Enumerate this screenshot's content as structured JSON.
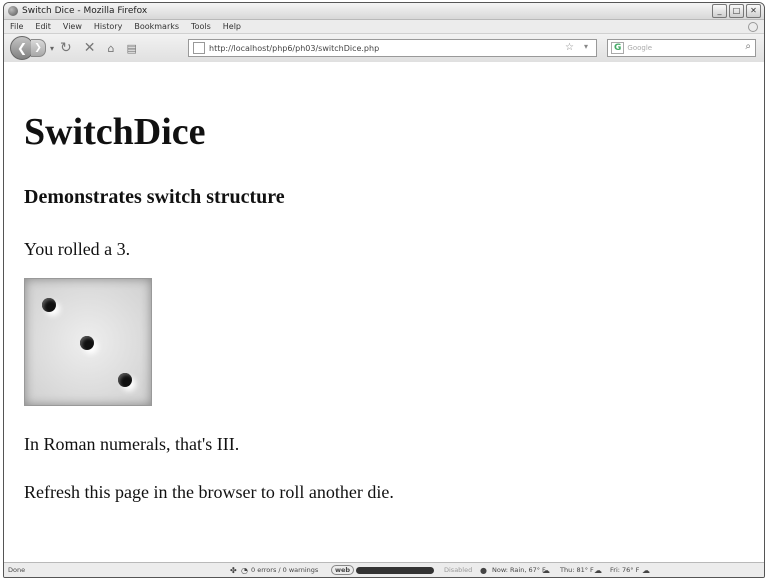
{
  "window": {
    "title": "Switch Dice - Mozilla Firefox"
  },
  "menu": [
    "File",
    "Edit",
    "View",
    "History",
    "Bookmarks",
    "Tools",
    "Help"
  ],
  "toolbar": {
    "url": "http://localhost/php6/ph03/switchDice.php",
    "search_placeholder": "Google"
  },
  "page": {
    "heading": "SwitchDice",
    "subheading": "Demonstrates switch structure",
    "rolled": "You rolled a 3.",
    "die_value": 3,
    "roman": "In Roman numerals, that's III.",
    "refresh": "Refresh this page in the browser to roll another die."
  },
  "status": {
    "left": "Done",
    "errors": "0 errors / 0 warnings",
    "webdev": "web",
    "disabled": "Disabled",
    "now": "Now: Rain, 67° F",
    "thu": "Thu: 81° F",
    "fri": "Fri: 76° F"
  }
}
